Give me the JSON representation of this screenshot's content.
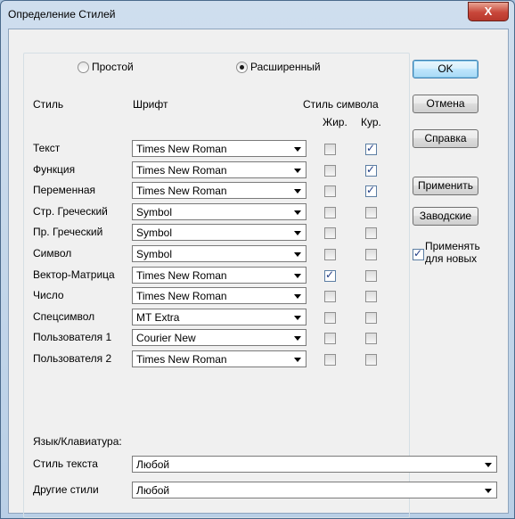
{
  "window": {
    "title": "Определение Стилей",
    "close_label": "X"
  },
  "mode": {
    "simple_label": "Простой",
    "advanced_label": "Расширенный",
    "selected": "advanced"
  },
  "headers": {
    "style": "Стиль",
    "font": "Шрифт",
    "char_style": "Стиль символа",
    "bold": "Жир.",
    "italic": "Кур."
  },
  "rows": [
    {
      "label": "Текст",
      "font": "Times New Roman",
      "bold": false,
      "italic": true
    },
    {
      "label": "Функция",
      "font": "Times New Roman",
      "bold": false,
      "italic": true
    },
    {
      "label": "Переменная",
      "font": "Times New Roman",
      "bold": false,
      "italic": true
    },
    {
      "label": "Стр. Греческий",
      "font": "Symbol",
      "bold": false,
      "italic": false
    },
    {
      "label": "Пр. Греческий",
      "font": "Symbol",
      "bold": false,
      "italic": false
    },
    {
      "label": "Символ",
      "font": "Symbol",
      "bold": false,
      "italic": false
    },
    {
      "label": "Вектор-Матрица",
      "font": "Times New Roman",
      "bold": true,
      "italic": false
    },
    {
      "label": "Число",
      "font": "Times New Roman",
      "bold": false,
      "italic": false
    },
    {
      "label": "Спецсимвол",
      "font": "MT Extra",
      "bold": false,
      "italic": false
    },
    {
      "label": "Пользователя 1",
      "font": "Courier New",
      "bold": false,
      "italic": false
    },
    {
      "label": "Пользователя 2",
      "font": "Times New Roman",
      "bold": false,
      "italic": false
    }
  ],
  "language": {
    "heading": "Язык/Клавиатура:",
    "text_style_label": "Стиль текста",
    "text_style_value": "Любой",
    "other_styles_label": "Другие стили",
    "other_styles_value": "Любой"
  },
  "buttons": {
    "ok": "OK",
    "cancel": "Отмена",
    "help": "Справка",
    "apply": "Применить",
    "factory": "Заводские"
  },
  "apply_new": {
    "line1": "Применять",
    "line2": "для новых",
    "checked": true
  }
}
